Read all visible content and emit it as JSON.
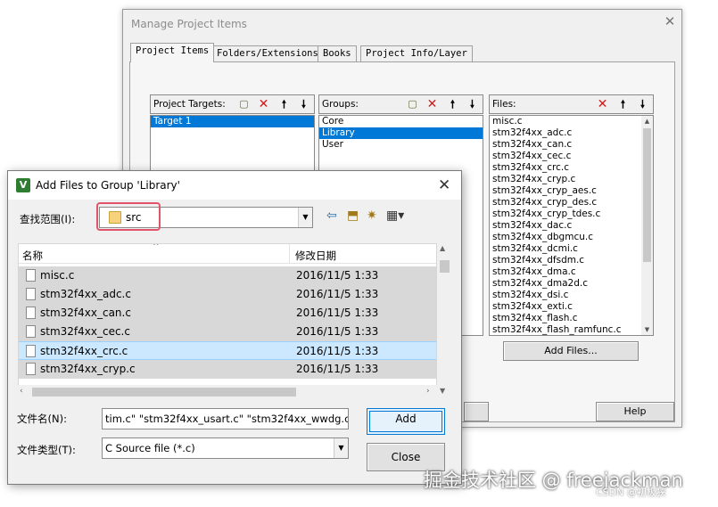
{
  "manage_dialog": {
    "title": "Manage Project Items",
    "tabs": [
      "Project Items",
      "Folders/Extensions",
      "Books",
      "Project Info/Layer"
    ],
    "project_targets": {
      "label": "Project Targets:",
      "items": [
        "Target 1"
      ]
    },
    "groups": {
      "label": "Groups:",
      "items": [
        "Core",
        "Library",
        "User"
      ]
    },
    "files": {
      "label": "Files:",
      "items": [
        "misc.c",
        "stm32f4xx_adc.c",
        "stm32f4xx_can.c",
        "stm32f4xx_cec.c",
        "stm32f4xx_crc.c",
        "stm32f4xx_cryp.c",
        "stm32f4xx_cryp_aes.c",
        "stm32f4xx_cryp_des.c",
        "stm32f4xx_cryp_tdes.c",
        "stm32f4xx_dac.c",
        "stm32f4xx_dbgmcu.c",
        "stm32f4xx_dcmi.c",
        "stm32f4xx_dfsdm.c",
        "stm32f4xx_dma.c",
        "stm32f4xx_dma2d.c",
        "stm32f4xx_dsi.c",
        "stm32f4xx_exti.c",
        "stm32f4xx_flash.c",
        "stm32f4xx_flash_ramfunc.c"
      ]
    },
    "add_files_button": "Add Files...",
    "help_button": "Help"
  },
  "add_files_dialog": {
    "title": "Add Files to Group 'Library'",
    "look_in_label": "查找范围(I):",
    "look_in_value": "src",
    "columns": {
      "name": "名称",
      "date": "修改日期"
    },
    "rows": [
      {
        "name": "misc.c",
        "date": "2016/11/5 1:33"
      },
      {
        "name": "stm32f4xx_adc.c",
        "date": "2016/11/5 1:33"
      },
      {
        "name": "stm32f4xx_can.c",
        "date": "2016/11/5 1:33"
      },
      {
        "name": "stm32f4xx_cec.c",
        "date": "2016/11/5 1:33"
      },
      {
        "name": "stm32f4xx_crc.c",
        "date": "2016/11/5 1:33"
      },
      {
        "name": "stm32f4xx_cryp.c",
        "date": "2016/11/5 1:33"
      }
    ],
    "file_name_label": "文件名(N):",
    "file_name_value": "tim.c\" \"stm32f4xx_usart.c\" \"stm32f4xx_wwdg.c\"",
    "file_type_label": "文件类型(T):",
    "file_type_value": "C Source file (*.c)",
    "add_button": "Add",
    "close_button": "Close"
  },
  "watermark": {
    "line1": "掘金技术社区 @ freejackman",
    "line2": "CSDN @初极狭"
  }
}
